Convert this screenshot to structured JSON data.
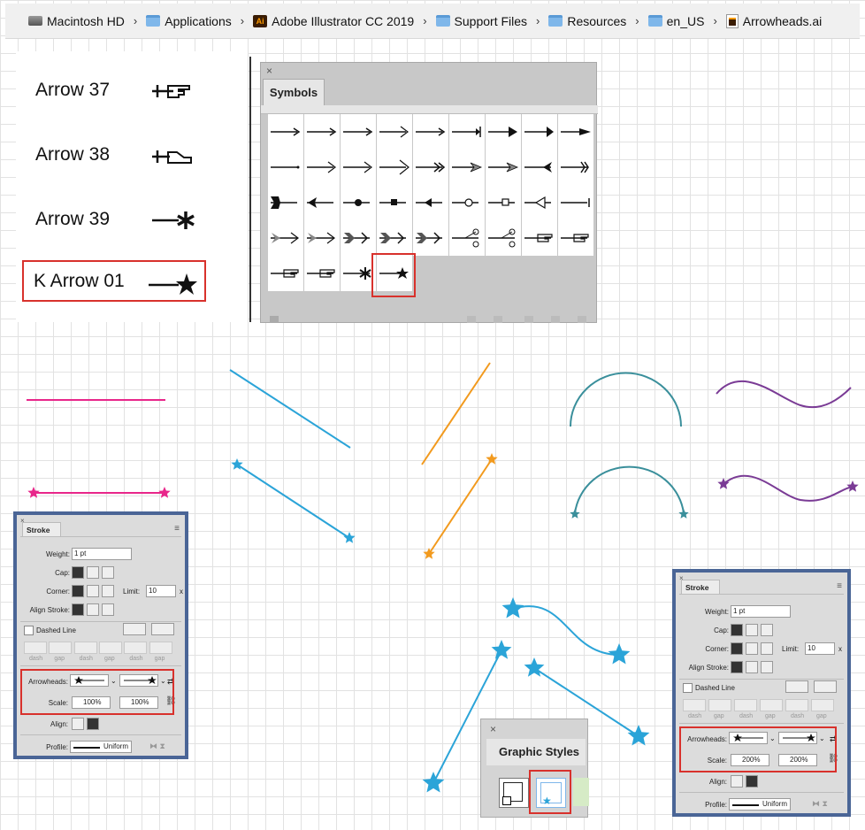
{
  "breadcrumb": [
    {
      "label": "Macintosh HD",
      "icon": "hard-disk-icon"
    },
    {
      "label": "Applications",
      "icon": "folder-icon"
    },
    {
      "label": "Adobe Illustrator CC 2019",
      "icon": "illustrator-app-icon"
    },
    {
      "label": "Support Files",
      "icon": "folder-icon"
    },
    {
      "label": "Resources",
      "icon": "folder-icon"
    },
    {
      "label": "en_US",
      "icon": "folder-icon"
    },
    {
      "label": "Arrowheads.ai",
      "icon": "ai-file-icon"
    }
  ],
  "arrow_list": [
    "Arrow 37",
    "Arrow 38",
    "Arrow 39",
    "K Arrow 01"
  ],
  "symbols_panel": {
    "title": "Symbols",
    "close": "×",
    "rows": [
      [
        "arrow-thin",
        "arrow-thin",
        "arrow-thin",
        "arrow-open",
        "arrow-thin",
        "arrow-bar",
        "arrow-solid",
        "arrow-solid-long",
        "arrow-fat"
      ],
      [
        "arrow-dot-tip",
        "arrow-open",
        "arrow-open",
        "arrow-open-wide",
        "arrow-double",
        "arrow-feather",
        "arrow-feather",
        "arrow-notch",
        "arrow-fletch"
      ],
      [
        "tail-notch-solid",
        "tail-notch",
        "circle",
        "square",
        "triangle-back",
        "circle-open",
        "square-open",
        "triangle-open",
        "bar-end"
      ],
      [
        "feather-tail",
        "feather-tail",
        "fletch",
        "fletch",
        "fletch",
        "scissors",
        "scissors",
        "hand-pointer",
        "hand-pointer"
      ],
      [
        "hand-pointer",
        "hand-pointer",
        "asterisk",
        "star"
      ]
    ]
  },
  "stroke_panel_left": {
    "title": "Stroke",
    "weight_label": "Weight:",
    "weight_value": "1 pt",
    "cap_label": "Cap:",
    "corner_label": "Corner:",
    "limit_label": "Limit:",
    "limit_value": "10",
    "limit_unit": "x",
    "align_label": "Align Stroke:",
    "dashed_label": "Dashed Line",
    "dash_labels": [
      "dash",
      "gap",
      "dash",
      "gap",
      "dash",
      "gap"
    ],
    "arrowheads_label": "Arrowheads:",
    "scale_label": "Scale:",
    "scale_start": "100%",
    "scale_end": "100%",
    "align2_label": "Align:",
    "profile_label": "Profile:",
    "profile_value": "Uniform"
  },
  "stroke_panel_right": {
    "title": "Stroke",
    "weight_label": "Weight:",
    "weight_value": "1 pt",
    "cap_label": "Cap:",
    "corner_label": "Corner:",
    "limit_label": "Limit:",
    "limit_value": "10",
    "limit_unit": "x",
    "align_label": "Align Stroke:",
    "dashed_label": "Dashed Line",
    "dash_labels": [
      "dash",
      "gap",
      "dash",
      "gap",
      "dash",
      "gap"
    ],
    "arrowheads_label": "Arrowheads:",
    "scale_label": "Scale:",
    "scale_start": "200%",
    "scale_end": "200%",
    "align2_label": "Align:",
    "profile_label": "Profile:",
    "profile_value": "Uniform"
  },
  "graphic_styles": {
    "title": "Graphic Styles",
    "close": "×"
  },
  "colors": {
    "pink": "#e8268a",
    "cyan": "#2ba4d8",
    "orange": "#f29a1e",
    "teal": "#3a8f9b",
    "purple": "#7a3b95",
    "highlight": "#d8312c",
    "panel_border": "#4a6596"
  }
}
